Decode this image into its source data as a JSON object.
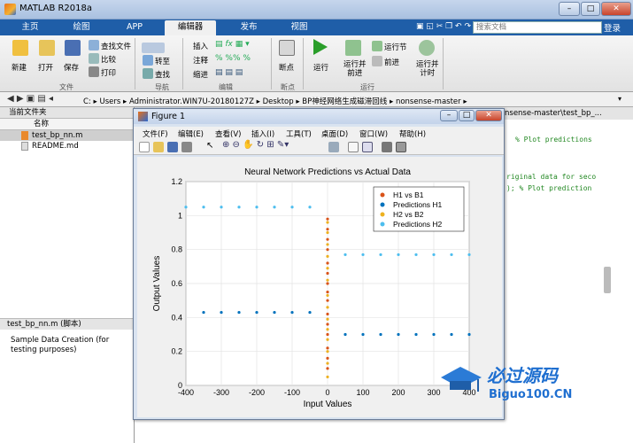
{
  "app": {
    "title": "MATLAB R2018a"
  },
  "tabs": [
    "主页",
    "绘图",
    "APP",
    "编辑器",
    "发布",
    "视图"
  ],
  "active_tab": "编辑器",
  "search": {
    "placeholder": "搜索文档"
  },
  "login": "登录",
  "ribbon": {
    "file": {
      "new": "新建",
      "open": "打开",
      "save": "保存",
      "find_files": "查找文件",
      "compare": "比较",
      "print": "打印",
      "section": "文件"
    },
    "navigate": {
      "goto": "转至",
      "find": "查找",
      "section": "导航"
    },
    "edit": {
      "insert": "插入",
      "comment": "注释",
      "indent": "缩进",
      "section": "编辑"
    },
    "breakpoints": {
      "label": "断点",
      "section": "断点"
    },
    "run": {
      "run": "运行",
      "run_advance": "运行并\n前进",
      "run_section": "运行节",
      "advance": "前进",
      "run_time": "运行并\n计时",
      "section": "运行"
    }
  },
  "address": {
    "path": [
      "C:",
      "Users",
      "Administrator.WIN7U-20180127Z",
      "Desktop",
      "BP神经网络生成磁滞回线",
      "nonsense-master"
    ]
  },
  "current_folder": {
    "header": "当前文件夹",
    "column": "名称",
    "files": [
      {
        "name": "test_bp_nn.m",
        "selected": true
      },
      {
        "name": "README.md",
        "selected": false
      }
    ]
  },
  "details": {
    "header": "test_bp_nn.m (脚本)",
    "text": "Sample Data Creation (for testing purposes)"
  },
  "editor": {
    "tab": "nsense-master\\test_bp_...",
    "lines": [
      "% Plot predictions",
      "",
      "",
      "riginal data for seco",
      "); % Plot prediction"
    ]
  },
  "figure": {
    "title": "Figure 1",
    "menu": [
      "文件(F)",
      "编辑(E)",
      "查看(V)",
      "插入(I)",
      "工具(T)",
      "桌面(D)",
      "窗口(W)",
      "帮助(H)"
    ]
  },
  "chart_data": {
    "type": "scatter",
    "title": "Neural Network Predictions vs Actual Data",
    "xlabel": "Input Values",
    "ylabel": "Output Values",
    "xlim": [
      -400,
      400
    ],
    "ylim": [
      0,
      1.2
    ],
    "xticks": [
      -400,
      -300,
      -200,
      -100,
      0,
      100,
      200,
      300,
      400
    ],
    "yticks": [
      0,
      0.2,
      0.4,
      0.6,
      0.8,
      1,
      1.2
    ],
    "grid": true,
    "legend_position": "top-right",
    "series": [
      {
        "name": "H1 vs B1",
        "color": "#d95319",
        "x": [
          0,
          0,
          0,
          0,
          0,
          0,
          0,
          0,
          0,
          0,
          0,
          0,
          0,
          0,
          0
        ],
        "y": [
          0.1,
          0.16,
          0.22,
          0.3,
          0.36,
          0.42,
          0.5,
          0.55,
          0.6,
          0.66,
          0.72,
          0.8,
          0.86,
          0.92,
          0.98
        ]
      },
      {
        "name": "Predictions H1",
        "color": "#0072bd",
        "x": [
          -350,
          -300,
          -250,
          -200,
          -150,
          -100,
          -50,
          50,
          100,
          150,
          200,
          250,
          300,
          350,
          400
        ],
        "y": [
          0.43,
          0.43,
          0.43,
          0.43,
          0.43,
          0.43,
          0.43,
          0.3,
          0.3,
          0.3,
          0.3,
          0.3,
          0.3,
          0.3,
          0.3
        ]
      },
      {
        "name": "H2 vs B2",
        "color": "#edb120",
        "x": [
          0,
          0,
          0,
          0,
          0,
          0,
          0,
          0,
          0,
          0,
          0,
          0,
          0,
          0
        ],
        "y": [
          0.05,
          0.13,
          0.2,
          0.27,
          0.33,
          0.39,
          0.46,
          0.53,
          0.62,
          0.69,
          0.76,
          0.83,
          0.9,
          0.96
        ]
      },
      {
        "name": "Predictions H2",
        "color": "#4dbeee",
        "x": [
          -400,
          -350,
          -300,
          -250,
          -200,
          -150,
          -100,
          -50,
          50,
          100,
          150,
          200,
          250,
          300,
          350,
          400
        ],
        "y": [
          1.05,
          1.05,
          1.05,
          1.05,
          1.05,
          1.05,
          1.05,
          1.05,
          0.77,
          0.77,
          0.77,
          0.77,
          0.77,
          0.77,
          0.77,
          0.77
        ]
      }
    ]
  },
  "watermark": {
    "text1": "必过源码",
    "text2": "Biguo100.CN"
  }
}
